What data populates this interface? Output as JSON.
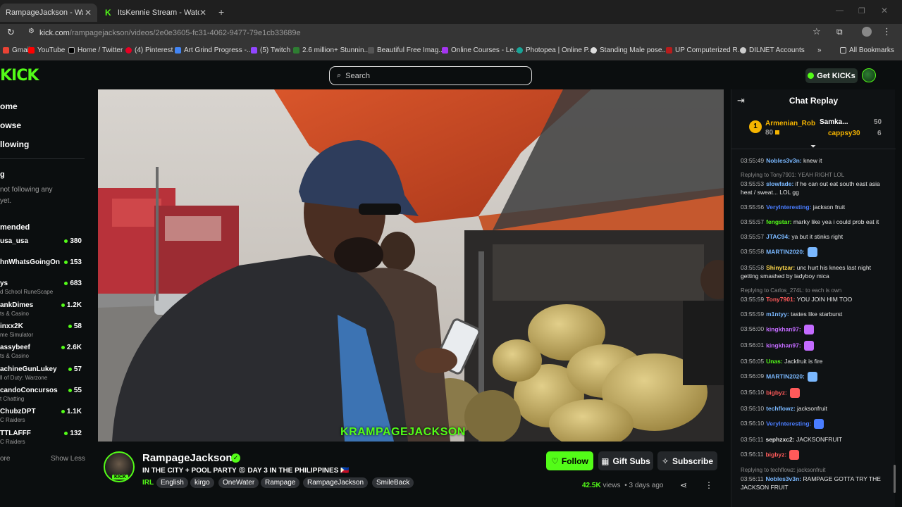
{
  "browser": {
    "tabs": [
      {
        "label": "RampageJackson - Watch the V",
        "active": true
      },
      {
        "label": "ItsKennie Stream - Watch Live",
        "active": false
      }
    ],
    "new_tab_icon": "plus-icon",
    "url_host": "kick.com",
    "url_path": "/rampagejackson/videos/2e0e3605-fc31-4062-9477-79e1cb33689e",
    "bookmarks": [
      "Gmail",
      "YouTube",
      "Home / Twitter",
      "(4) Pinterest",
      "Art Grind Progress -...",
      "(5) Twitch",
      "2.6 million+ Stunnin...",
      "Beautiful Free Imag...",
      "Online Courses - Le...",
      "Photopea | Online P...",
      "Standing Male pose...",
      "UP Computerized R...",
      "DILNET Accounts"
    ],
    "all_bookmarks": "All Bookmarks"
  },
  "header": {
    "logo": "KICK",
    "search_placeholder": "Search",
    "get_kicks": "Get KICKs"
  },
  "sidebar": {
    "nav": [
      "ome",
      "owse",
      "llowing"
    ],
    "following_head": "g",
    "following_empty_1": "not following any",
    "following_empty_2": "yet.",
    "recommended_head": "mended",
    "recommended": [
      {
        "name": "usa_usa",
        "category": "",
        "viewers": "380"
      },
      {
        "name": "hnWhatsGoingOn",
        "category": "",
        "viewers": "153"
      },
      {
        "name": "ys",
        "category": "d School RuneScape",
        "viewers": "683"
      },
      {
        "name": "ankDimes",
        "category": "ts & Casino",
        "viewers": "1.2K"
      },
      {
        "name": "inxx2K",
        "category": "me Simulator",
        "viewers": "58"
      },
      {
        "name": "assybeef",
        "category": "ts & Casino",
        "viewers": "2.6K"
      },
      {
        "name": "achineGunLukey",
        "category": "ll of Duty: Warzone",
        "viewers": "57"
      },
      {
        "name": "candoConcursos",
        "category": "t Chatting",
        "viewers": "55"
      },
      {
        "name": "ChubzDPT",
        "category": "C Raiders",
        "viewers": "1.1K"
      },
      {
        "name": "TTLAFFF",
        "category": "C Raiders",
        "viewers": "132"
      }
    ],
    "show_more": "ore",
    "show_less": "Show Less"
  },
  "video": {
    "caption_k": "K",
    "caption_rest": "RAMPAGEJACKSON"
  },
  "info": {
    "channel": "RampageJackson",
    "title": "IN THE CITY + POOL PARTY 😡 DAY 3 IN THE PHILIPPINES 🇵🇭",
    "category": "IRL",
    "tags": [
      "English",
      "kirgo",
      "OneWater",
      "Rampage",
      "RampageJackson",
      "SmileBack"
    ],
    "follow": "Follow",
    "gift_subs": "Gift Subs",
    "subscribe": "Subscribe",
    "views": "42.5K",
    "views_label": "views",
    "age": "• 3 days ago"
  },
  "chat": {
    "title": "Chat Replay",
    "gifters": [
      {
        "name": "Armenian_Rob",
        "amount": "80"
      },
      {
        "name": "Samka...",
        "amount": "50"
      },
      {
        "name": "cappsy30",
        "amount": "6"
      }
    ],
    "messages": [
      {
        "time": "03:55:49",
        "user": "Nobles3v3n:",
        "color": "#7ab8ff",
        "text": "knew it"
      },
      {
        "reply": "Replying to Tony7901: YEAH RIGHT LOL"
      },
      {
        "time": "03:55:53",
        "user": "slowfade:",
        "color": "#7ab8ff",
        "text": "if he can out eat south east asia heat / sweat... LOL gg"
      },
      {
        "time": "03:55:56",
        "user": "VeryInteresting:",
        "color": "#4a7dff",
        "text": "jackson fruit"
      },
      {
        "time": "03:55:57",
        "user": "fengstar:",
        "color": "#53fc18",
        "text": "marky like yea i could prob eat it"
      },
      {
        "time": "03:55:57",
        "user": "JTAC94:",
        "color": "#7ab8ff",
        "text": "ya but it stinks right"
      },
      {
        "time": "03:55:58",
        "user": "MARTIN2020:",
        "color": "#7ab8ff",
        "text": ""
      },
      {
        "time": "03:55:58",
        "user": "Shinytzar:",
        "color": "#ffd84a",
        "text": "unc hurt his knees last night getting smashed by ladyboy mica"
      },
      {
        "reply": "Replying to Carlos_274L: to each is own"
      },
      {
        "time": "03:55:59",
        "user": "Tony7901:",
        "color": "#ff5a5a",
        "text": "YOU JOIN HIM TOO"
      },
      {
        "time": "03:55:59",
        "user": "m1ntyy:",
        "color": "#7ab8ff",
        "text": "tastes like starburst"
      },
      {
        "time": "03:56:00",
        "user": "kingkhan97:",
        "color": "#c36bff",
        "text": ""
      },
      {
        "time": "03:56:01",
        "user": "kingkhan97:",
        "color": "#c36bff",
        "text": ""
      },
      {
        "time": "03:56:05",
        "user": "Unas:",
        "color": "#53fc18",
        "text": "Jackfruit is fire"
      },
      {
        "time": "03:56:09",
        "user": "MARTIN2020:",
        "color": "#7ab8ff",
        "text": ""
      },
      {
        "time": "03:56:10",
        "user": "bigbyz:",
        "color": "#ff5a5a",
        "text": ""
      },
      {
        "time": "03:56:10",
        "user": "techflowz:",
        "color": "#7ab8ff",
        "text": "jacksonfruit"
      },
      {
        "time": "03:56:10",
        "user": "VeryInteresting:",
        "color": "#4a7dff",
        "text": ""
      },
      {
        "time": "03:56:11",
        "user": "sephzxc2:",
        "color": "#e6e6e6",
        "text": "JACKSONFRUIT"
      },
      {
        "time": "03:56:11",
        "user": "bigbyz:",
        "color": "#ff5a5a",
        "text": ""
      },
      {
        "reply": "Replying to techflowz: jacksonfruit"
      },
      {
        "time": "03:56:11",
        "user": "Nobles3v3n:",
        "color": "#7ab8ff",
        "text": "RAMPAGE GOTTA TRY THE JACKSON FRUIT"
      }
    ]
  },
  "colors": {
    "accent": "#53fc18",
    "bg": "#0b0e0f"
  }
}
